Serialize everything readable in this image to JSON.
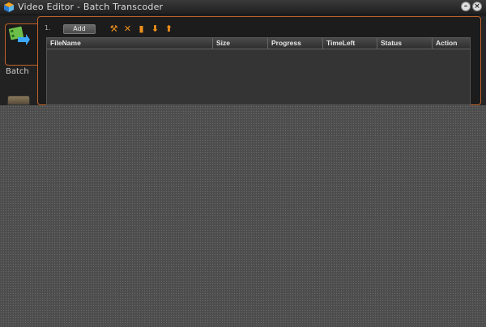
{
  "window": {
    "title": "Video Editor - Batch Transcoder"
  },
  "sidebar": {
    "items": [
      {
        "label": "Batch",
        "icon": "batch-film-icon",
        "active": true
      },
      {
        "label": "",
        "icon": "media-icon",
        "active": false
      }
    ]
  },
  "toolbar": {
    "row_number": "1.",
    "add_label": "Add",
    "tools": [
      {
        "icon": "wrench-icon",
        "glyph": "⚒"
      },
      {
        "icon": "delete-x-icon",
        "glyph": "✕"
      },
      {
        "icon": "trash-icon",
        "glyph": "▮"
      },
      {
        "icon": "move-down-icon",
        "glyph": "⬇"
      },
      {
        "icon": "move-up-icon",
        "glyph": "⬆"
      }
    ]
  },
  "table": {
    "columns": [
      "FileName",
      "Size",
      "Progress",
      "TimeLeft",
      "Status",
      "Action"
    ],
    "rows": []
  },
  "colors": {
    "accent": "#c0622a",
    "tool_icon": "#f0901c"
  }
}
